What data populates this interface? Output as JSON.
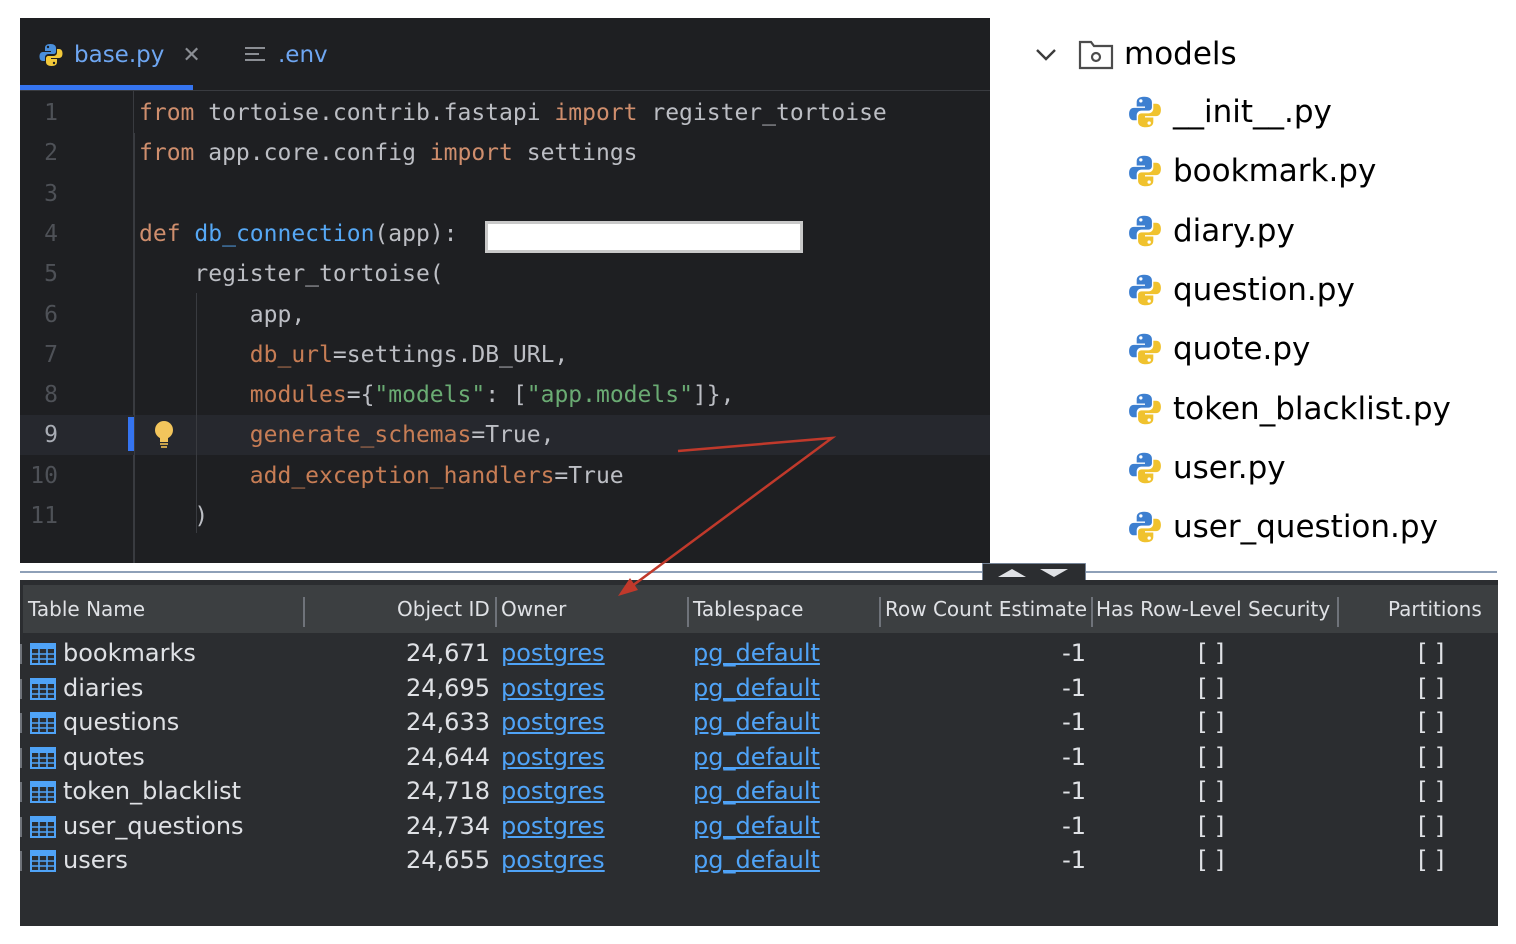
{
  "editor": {
    "tabs": [
      {
        "label": "base.py",
        "icon": "python-file-icon",
        "active": true
      },
      {
        "label": ".env",
        "icon": "text-file-icon",
        "active": false
      }
    ],
    "lines": [
      {
        "num": "1",
        "tokens": [
          [
            "kw",
            "from"
          ],
          [
            "t",
            " tortoise.contrib.fastapi "
          ],
          [
            "kw",
            "import"
          ],
          [
            "t",
            " register_tortoise"
          ]
        ]
      },
      {
        "num": "2",
        "tokens": [
          [
            "kw",
            "from"
          ],
          [
            "t",
            " app.core.config "
          ],
          [
            "kw",
            "import"
          ],
          [
            "t",
            " settings"
          ]
        ]
      },
      {
        "num": "3",
        "tokens": []
      },
      {
        "num": "4",
        "tokens": [
          [
            "kw",
            "def"
          ],
          [
            "t",
            " "
          ],
          [
            "fn",
            "db_connection"
          ],
          [
            "t",
            "(app):"
          ]
        ]
      },
      {
        "num": "5",
        "tokens": [
          [
            "t",
            "    register_tortoise("
          ]
        ]
      },
      {
        "num": "6",
        "tokens": [
          [
            "t",
            "        app,"
          ]
        ]
      },
      {
        "num": "7",
        "tokens": [
          [
            "t",
            "        "
          ],
          [
            "param",
            "db_url"
          ],
          [
            "t",
            "=settings.DB_URL,"
          ]
        ]
      },
      {
        "num": "8",
        "tokens": [
          [
            "t",
            "        "
          ],
          [
            "param",
            "modules"
          ],
          [
            "t",
            "={"
          ],
          [
            "str",
            "\"models\""
          ],
          [
            "t",
            ": ["
          ],
          [
            "str",
            "\"app.models\""
          ],
          [
            "t",
            "]},"
          ]
        ]
      },
      {
        "num": "9",
        "tokens": [
          [
            "t",
            "        "
          ],
          [
            "param",
            "generate_schemas"
          ],
          [
            "t",
            "=True,"
          ]
        ]
      },
      {
        "num": "10",
        "tokens": [
          [
            "t",
            "        "
          ],
          [
            "param",
            "add_exception_handlers"
          ],
          [
            "t",
            "=True"
          ]
        ]
      },
      {
        "num": "11",
        "tokens": [
          [
            "t",
            "    )"
          ]
        ]
      }
    ],
    "current_line": 9,
    "colors": {
      "keyword": "#cf8e6d",
      "function": "#56a8f5",
      "param": "#c77d55",
      "string": "#6aab73",
      "text": "#bcbec4"
    }
  },
  "tree": {
    "folder": "models",
    "files": [
      "__init__.py",
      "bookmark.py",
      "diary.py",
      "question.py",
      "quote.py",
      "token_blacklist.py",
      "user.py",
      "user_question.py"
    ]
  },
  "table": {
    "columns": [
      "Table Name",
      "Object ID",
      "Owner",
      "Tablespace",
      "Row Count Estimate",
      "Has Row-Level Security",
      "Partitions"
    ],
    "rows": [
      {
        "name": "bookmarks",
        "oid": "24,671",
        "owner": "postgres",
        "tablespace": "pg_default",
        "rows": "-1",
        "rls": "[ ]",
        "partitions": "[ ]"
      },
      {
        "name": "diaries",
        "oid": "24,695",
        "owner": "postgres",
        "tablespace": "pg_default",
        "rows": "-1",
        "rls": "[ ]",
        "partitions": "[ ]"
      },
      {
        "name": "questions",
        "oid": "24,633",
        "owner": "postgres",
        "tablespace": "pg_default",
        "rows": "-1",
        "rls": "[ ]",
        "partitions": "[ ]"
      },
      {
        "name": "quotes",
        "oid": "24,644",
        "owner": "postgres",
        "tablespace": "pg_default",
        "rows": "-1",
        "rls": "[ ]",
        "partitions": "[ ]"
      },
      {
        "name": "token_blacklist",
        "oid": "24,718",
        "owner": "postgres",
        "tablespace": "pg_default",
        "rows": "-1",
        "rls": "[ ]",
        "partitions": "[ ]"
      },
      {
        "name": "user_questions",
        "oid": "24,734",
        "owner": "postgres",
        "tablespace": "pg_default",
        "rows": "-1",
        "rls": "[ ]",
        "partitions": "[ ]"
      },
      {
        "name": "users",
        "oid": "24,655",
        "owner": "postgres",
        "tablespace": "pg_default",
        "rows": "-1",
        "rls": "[ ]",
        "partitions": "[ ]"
      }
    ]
  },
  "annotation": {
    "arrow_color": "#c0392b"
  }
}
